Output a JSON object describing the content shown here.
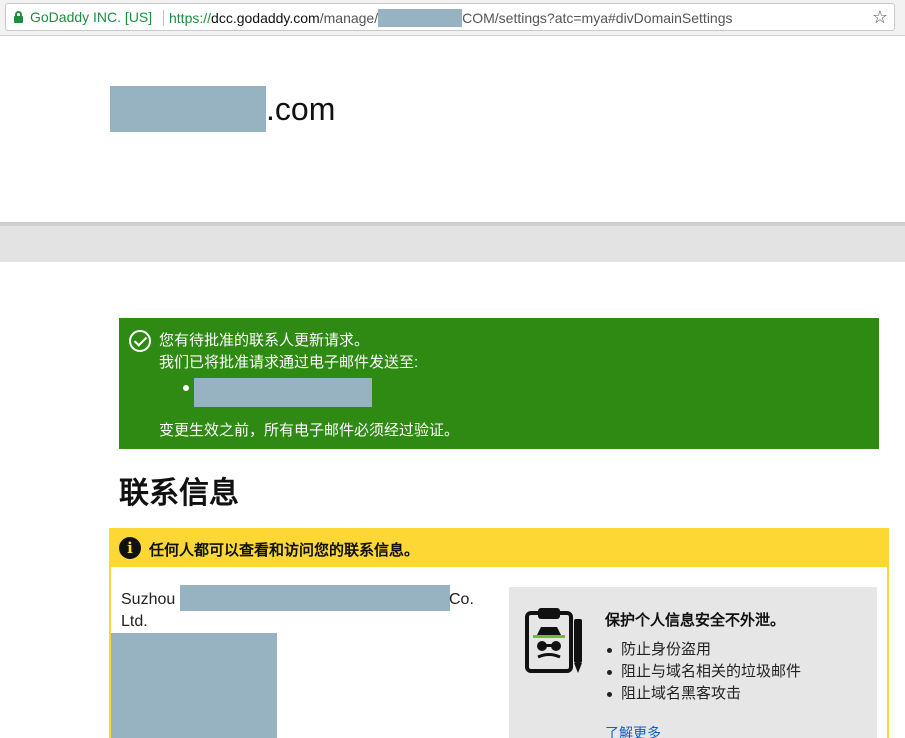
{
  "browser": {
    "site_identity": "GoDaddy INC. [US]",
    "url_scheme": "https://",
    "url_host": "dcc.godaddy.com",
    "url_path_prefix": "/manage/",
    "url_path_suffix": "COM/settings?atc=mya#divDomainSettings"
  },
  "domain": {
    "tld_label": ".com"
  },
  "notice": {
    "line1": "您有待批准的联系人更新请求。",
    "line2": "我们已将批准请求通过电子邮件发送至:",
    "line3": "变更生效之前，所有电子邮件必须经过验证。"
  },
  "contact": {
    "section_title": "联系信息",
    "banner_text": "任何人都可以查看和访问您的联系信息。",
    "org_prefix": "Suzhou",
    "org_suffix": "Co.",
    "org_line2": "Ltd."
  },
  "privacy_promo": {
    "title": "保护个人信息安全不外泄。",
    "items": [
      "防止身份盗用",
      "阻止与域名相关的垃圾邮件",
      "阻止域名黑客攻击"
    ],
    "link": "了解更多"
  }
}
